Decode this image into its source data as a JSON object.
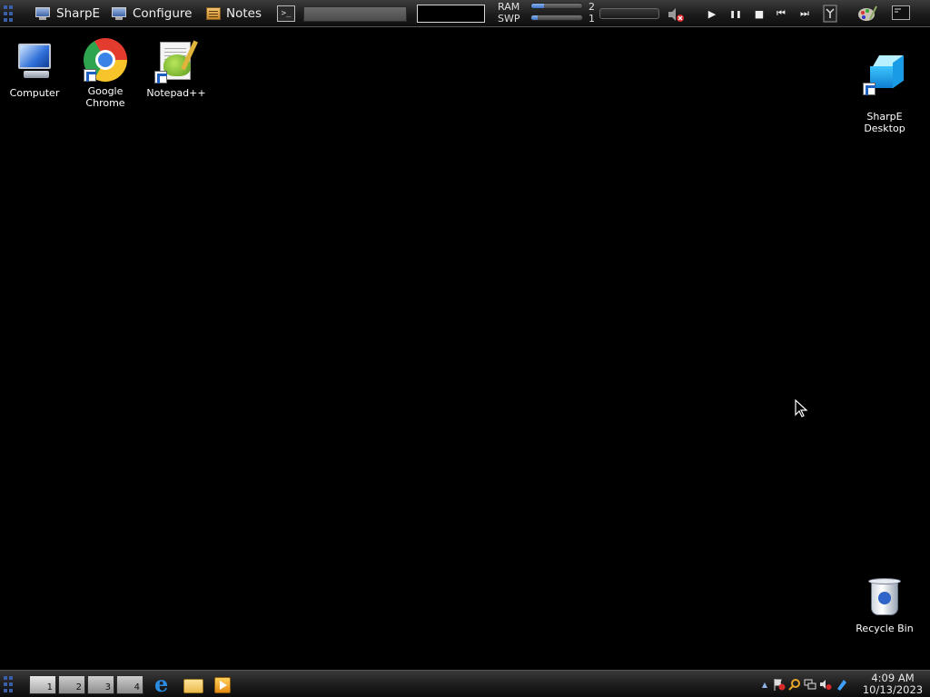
{
  "topbar": {
    "menus": [
      {
        "label": "SharpE",
        "icon": "monitor-icon"
      },
      {
        "label": "Configure",
        "icon": "monitor-icon"
      },
      {
        "label": "Notes",
        "icon": "notes-icon"
      }
    ],
    "terminal_glyph": ">_",
    "memory": {
      "ram_label": "RAM",
      "ram_value": "2",
      "ram_fraction": 0.25,
      "swp_label": "SWP",
      "swp_value": "1",
      "swp_fraction": 0.12
    },
    "media_controls": [
      "play",
      "pause",
      "stop",
      "previous",
      "next"
    ],
    "media_glyphs": {
      "play": "▶",
      "pause": "❚❚",
      "stop": "■",
      "previous": "⏮",
      "next": "⏭"
    }
  },
  "desktop": {
    "icons": [
      {
        "label": "Computer",
        "icon": "computer-icon"
      },
      {
        "label": "Google Chrome",
        "icon": "chrome-icon"
      },
      {
        "label": "Notepad++",
        "icon": "notepadpp-icon"
      },
      {
        "label": "SharpE\nDesktop",
        "icon": "sharpe-desktop-icon"
      },
      {
        "label": "Recycle Bin",
        "icon": "recycle-bin-icon"
      }
    ]
  },
  "taskbar": {
    "workspaces": [
      "1",
      "2",
      "3",
      "4"
    ],
    "quick_launch": [
      "internet-explorer-icon",
      "file-explorer-icon",
      "media-player-icon"
    ],
    "ie_glyph": "e",
    "tray_up_arrow": "▲",
    "clock": {
      "time": "4:09 AM",
      "date": "10/13/2023"
    }
  },
  "colors": {
    "accent": "#3b5ea8",
    "desktop_bg": "#000000",
    "bar_fill": "#3d70c4"
  }
}
